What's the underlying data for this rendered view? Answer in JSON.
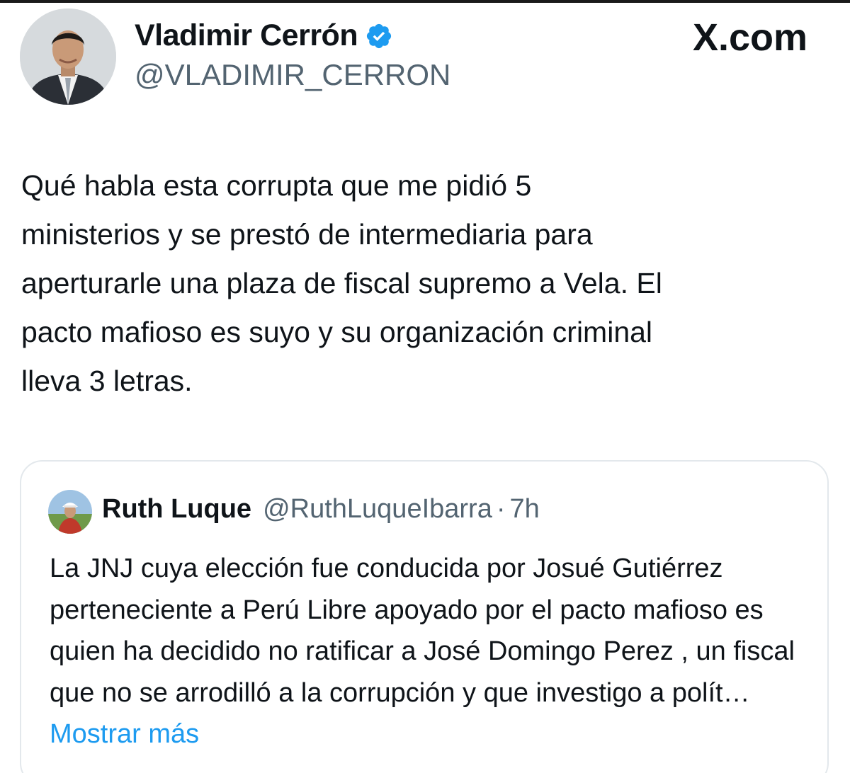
{
  "author": {
    "display_name": "Vladimir Cerrón",
    "handle": "@VLADIMIR_CERRON",
    "verified": true
  },
  "brand": {
    "label": "X.com"
  },
  "tweet": {
    "text": "Qué habla esta corrupta que me pidió 5\nministerios y se prestó de intermediaria para\naperturarle una plaza de fiscal supremo a Vela. El\npacto mafioso es suyo y su organización criminal\nlleva 3 letras."
  },
  "quote": {
    "display_name": "Ruth Luque",
    "handle": "@RuthLuqueIbarra",
    "separator": "·",
    "time": "7h",
    "text": "La JNJ cuya elección fue conducida por Josué Gutiérrez perteneciente a Perú Libre apoyado por el pacto mafioso es quien ha decidido no ratificar a José Domingo Perez , un fiscal que no se arrodilló a la corrupción y que investigo a polít…",
    "show_more": "Mostrar más"
  },
  "colors": {
    "text_primary": "#0f1419",
    "text_secondary": "#536471",
    "link": "#1d9bf0",
    "verified_badge": "#1d9bf0",
    "card_border": "#e3e8ec"
  },
  "icons": {
    "verified": "verified-badge-icon",
    "author_avatar": "profile-photo",
    "quote_avatar": "profile-photo"
  }
}
